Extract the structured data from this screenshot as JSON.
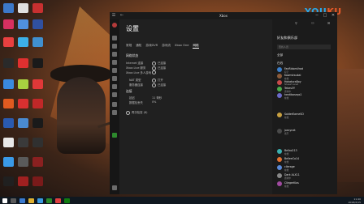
{
  "watermark": {
    "brand_main": "YOU",
    "brand_accent": "KU"
  },
  "window": {
    "title": "Xbox",
    "settings_title": "设置",
    "tabs": [
      {
        "label": "常规"
      },
      {
        "label": "通知"
      },
      {
        "label": "游戏DVR"
      },
      {
        "label": "游戏流"
      },
      {
        "label": "Xbox One"
      },
      {
        "label": "网络"
      }
    ],
    "sections": [
      {
        "label": "网络状态"
      },
      {
        "label": "连接"
      }
    ],
    "network_rows": [
      {
        "label": "Internet 连接",
        "value": "已连接"
      },
      {
        "label": "Xbox Live 服务",
        "value": "已连接"
      },
      {
        "label": "Xbox Live 多人游戏",
        "value": ""
      },
      {
        "label": "NAT 类型",
        "value": "打开"
      },
      {
        "label": "服务器连接",
        "value": "已连接"
      },
      {
        "label": "延迟",
        "value": "11 毫秒"
      },
      {
        "label": "数据包丢失",
        "value": "0%"
      }
    ],
    "check_again": "再次检查 (8)"
  },
  "social": {
    "heading": "好友和俱乐部",
    "search_placeholder": "查找人员",
    "section_all": "全部",
    "section_online": "在线",
    "friends": [
      {
        "name": "FanRidomVrad",
        "status": "有空",
        "color": "#3a7dc8"
      },
      {
        "name": "Kowmiraukal",
        "status": "在线",
        "color": "#8a5a3a"
      },
      {
        "name": "HokaturaBoy",
        "status": "Shaeef Lanat",
        "color": "#c84a4a"
      },
      {
        "name": "Tebes3Y",
        "status": "游戏中",
        "color": "#4aa84a"
      },
      {
        "name": "hentiboseps1",
        "status": "在线",
        "color": "#6a6ac8"
      },
      {
        "name": "SolderEarneSO",
        "status": "在线",
        "color": "#c8a040"
      },
      {
        "name": "joecynet",
        "status": "离开",
        "color": "#4a4a4a"
      },
      {
        "name": "Bellaz213",
        "status": "在线",
        "color": "#3ab0b0"
      },
      {
        "name": "BelleeCo14",
        "status": "在线",
        "color": "#e07030"
      },
      {
        "name": "cllerage",
        "status": "在线",
        "color": "#5a8ad8"
      },
      {
        "name": "Dark ALX11",
        "status": "游戏中",
        "color": "#888888"
      },
      {
        "name": "CllegerKlos",
        "status": "在线",
        "color": "#a04aa0"
      }
    ]
  },
  "tray": {
    "time": "11:40",
    "date": "2018/2/15"
  }
}
